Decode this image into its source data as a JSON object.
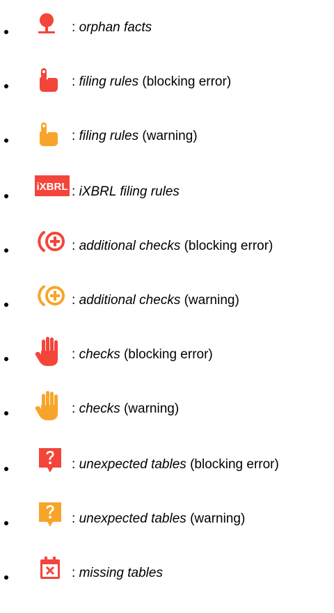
{
  "legend": {
    "separator": ":",
    "items": [
      {
        "icon": "orphan-pin-icon",
        "term": "orphan facts",
        "qualifier": "",
        "color": "#f4453a"
      },
      {
        "icon": "pointing-hand-icon",
        "term": "filing rules",
        "qualifier": "(blocking error)",
        "color": "#f4453a"
      },
      {
        "icon": "pointing-hand-icon",
        "term": "filing rules",
        "qualifier": "(warning)",
        "color": "#f7a52a"
      },
      {
        "icon": "ixbrl-badge-icon",
        "badge_text": "iXBRL",
        "term": "iXBRL filing rules",
        "qualifier": "",
        "color": "#f4453a"
      },
      {
        "icon": "additional-check-icon",
        "term": "additional checks",
        "qualifier": "(blocking error)",
        "color": "#f4453a"
      },
      {
        "icon": "additional-check-icon",
        "term": "additional checks",
        "qualifier": "(warning)",
        "color": "#f7a52a"
      },
      {
        "icon": "stop-hand-icon",
        "term": "checks",
        "qualifier": "(blocking error)",
        "color": "#f4453a"
      },
      {
        "icon": "stop-hand-icon",
        "term": "checks",
        "qualifier": "(warning)",
        "color": "#f7a52a"
      },
      {
        "icon": "question-badge-icon",
        "term": "unexpected tables",
        "qualifier": "(blocking error)",
        "color": "#f4453a"
      },
      {
        "icon": "question-badge-icon",
        "term": "unexpected tables",
        "qualifier": "(warning)",
        "color": "#f7a52a"
      },
      {
        "icon": "missing-calendar-icon",
        "term": "missing tables",
        "qualifier": "",
        "color": "#f4453a"
      }
    ]
  }
}
